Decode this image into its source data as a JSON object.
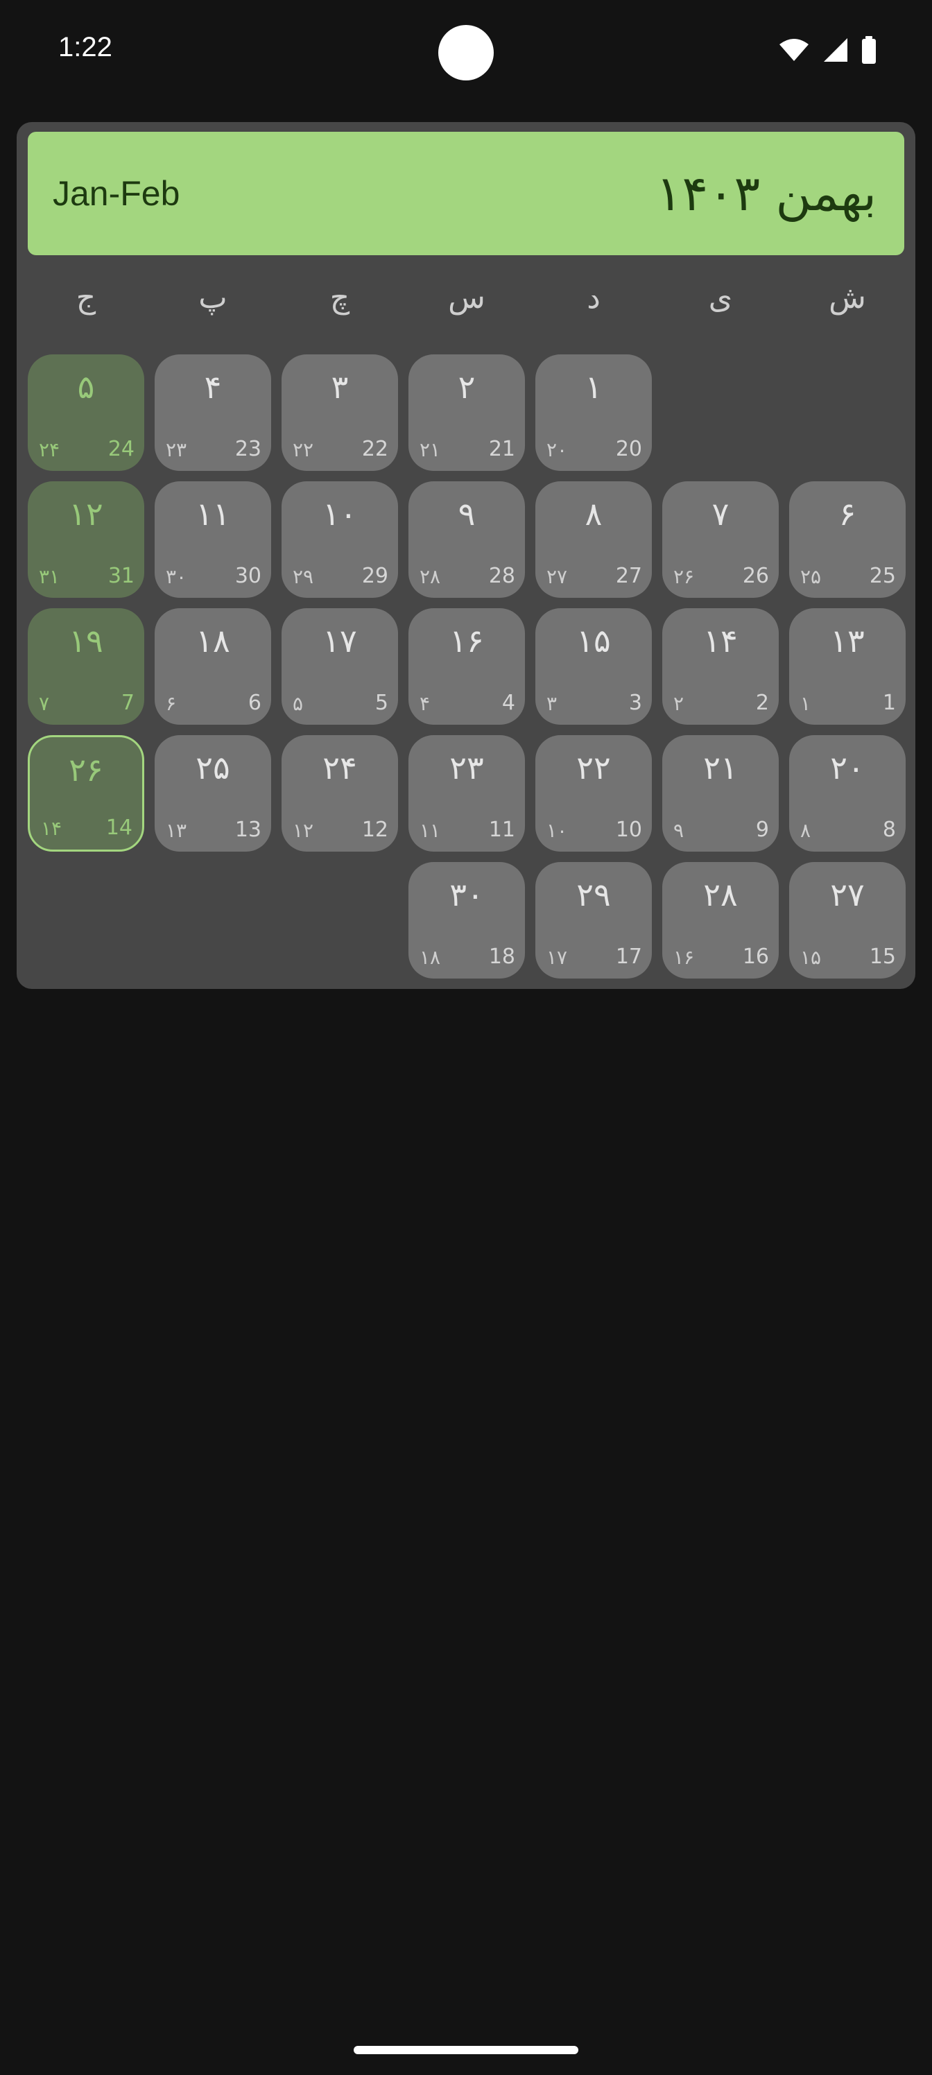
{
  "status_bar": {
    "time": "1:22",
    "icons": [
      "wifi-icon",
      "signal-icon",
      "battery-icon"
    ]
  },
  "calendar": {
    "header": {
      "gregorian_months": "Jan-Feb",
      "persian_month_year": "بهمن ۱۴۰۳"
    },
    "colors": {
      "accent": "#a3d67f",
      "background": "#474747",
      "cell": "#737373",
      "friday_cell": "#5e7153"
    },
    "weekdays": [
      "ج",
      "پ",
      "چ",
      "س",
      "د",
      "ی",
      "ش"
    ],
    "rows": [
      [
        {
          "day": "۵",
          "pgreg": "۲۴",
          "greg": "24",
          "friday": true
        },
        {
          "day": "۴",
          "pgreg": "۲۳",
          "greg": "23"
        },
        {
          "day": "۳",
          "pgreg": "۲۲",
          "greg": "22"
        },
        {
          "day": "۲",
          "pgreg": "۲۱",
          "greg": "21"
        },
        {
          "day": "۱",
          "pgreg": "۲۰",
          "greg": "20"
        },
        null,
        null
      ],
      [
        {
          "day": "۱۲",
          "pgreg": "۳۱",
          "greg": "31",
          "friday": true
        },
        {
          "day": "۱۱",
          "pgreg": "۳۰",
          "greg": "30"
        },
        {
          "day": "۱۰",
          "pgreg": "۲۹",
          "greg": "29"
        },
        {
          "day": "۹",
          "pgreg": "۲۸",
          "greg": "28"
        },
        {
          "day": "۸",
          "pgreg": "۲۷",
          "greg": "27"
        },
        {
          "day": "۷",
          "pgreg": "۲۶",
          "greg": "26"
        },
        {
          "day": "۶",
          "pgreg": "۲۵",
          "greg": "25"
        }
      ],
      [
        {
          "day": "۱۹",
          "pgreg": "۷",
          "greg": "7",
          "friday": true
        },
        {
          "day": "۱۸",
          "pgreg": "۶",
          "greg": "6"
        },
        {
          "day": "۱۷",
          "pgreg": "۵",
          "greg": "5"
        },
        {
          "day": "۱۶",
          "pgreg": "۴",
          "greg": "4"
        },
        {
          "day": "۱۵",
          "pgreg": "۳",
          "greg": "3"
        },
        {
          "day": "۱۴",
          "pgreg": "۲",
          "greg": "2"
        },
        {
          "day": "۱۳",
          "pgreg": "۱",
          "greg": "1"
        }
      ],
      [
        {
          "day": "۲۶",
          "pgreg": "۱۴",
          "greg": "14",
          "friday": true,
          "today": true
        },
        {
          "day": "۲۵",
          "pgreg": "۱۳",
          "greg": "13"
        },
        {
          "day": "۲۴",
          "pgreg": "۱۲",
          "greg": "12"
        },
        {
          "day": "۲۳",
          "pgreg": "۱۱",
          "greg": "11"
        },
        {
          "day": "۲۲",
          "pgreg": "۱۰",
          "greg": "10"
        },
        {
          "day": "۲۱",
          "pgreg": "۹",
          "greg": "9"
        },
        {
          "day": "۲۰",
          "pgreg": "۸",
          "greg": "8"
        }
      ],
      [
        null,
        null,
        null,
        {
          "day": "۳۰",
          "pgreg": "۱۸",
          "greg": "18"
        },
        {
          "day": "۲۹",
          "pgreg": "۱۷",
          "greg": "17"
        },
        {
          "day": "۲۸",
          "pgreg": "۱۶",
          "greg": "16"
        },
        {
          "day": "۲۷",
          "pgreg": "۱۵",
          "greg": "15"
        }
      ]
    ]
  }
}
